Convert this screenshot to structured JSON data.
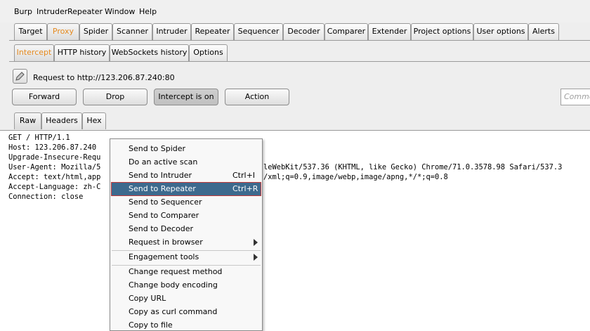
{
  "menubar": [
    "Burp",
    "Intruder",
    "Repeater",
    "Window",
    "Help"
  ],
  "main_tabs": [
    "Target",
    "Proxy",
    "Spider",
    "Scanner",
    "Intruder",
    "Repeater",
    "Sequencer",
    "Decoder",
    "Comparer",
    "Extender",
    "Project options",
    "User options",
    "Alerts"
  ],
  "proxy_tabs": [
    "Intercept",
    "HTTP history",
    "WebSockets history",
    "Options"
  ],
  "request_label": "Request to http://123.206.87.240:80",
  "buttons": {
    "forward": "Forward",
    "drop": "Drop",
    "intercept": "Intercept is on",
    "action": "Action"
  },
  "comment_placeholder": "Comme",
  "view_tabs": [
    "Raw",
    "Headers",
    "Hex"
  ],
  "request_lines": [
    "GET / HTTP/1.1",
    "Host: 123.206.87.240",
    "Upgrade-Insecure-Requ",
    "User-Agent: Mozilla/5",
    "Accept: text/html,app",
    "Accept-Language: zh-C",
    "Connection: close"
  ],
  "request_line_tails": [
    "",
    "",
    "",
    "leWebKit/537.36 (KHTML, like Gecko) Chrome/71.0.3578.98 Safari/537.3",
    "/xml;q=0.9,image/webp,image/apng,*/*;q=0.8",
    "",
    ""
  ],
  "context_menu": [
    {
      "label": "Send to Spider"
    },
    {
      "label": "Do an active scan"
    },
    {
      "label": "Send to Intruder",
      "shortcut": "Ctrl+I"
    },
    {
      "label": "Send to Repeater",
      "shortcut": "Ctrl+R"
    },
    {
      "label": "Send to Sequencer"
    },
    {
      "label": "Send to Comparer"
    },
    {
      "label": "Send to Decoder"
    },
    {
      "label": "Request in browser"
    },
    {
      "label": "Engagement tools"
    },
    {
      "label": "Change request method"
    },
    {
      "label": "Change body encoding"
    },
    {
      "label": "Copy URL"
    },
    {
      "label": "Copy as curl command"
    },
    {
      "label": "Copy to file"
    }
  ],
  "colors": {
    "selected_tab_text": "#e58a1f",
    "menu_highlight": "#3d6a8e"
  }
}
